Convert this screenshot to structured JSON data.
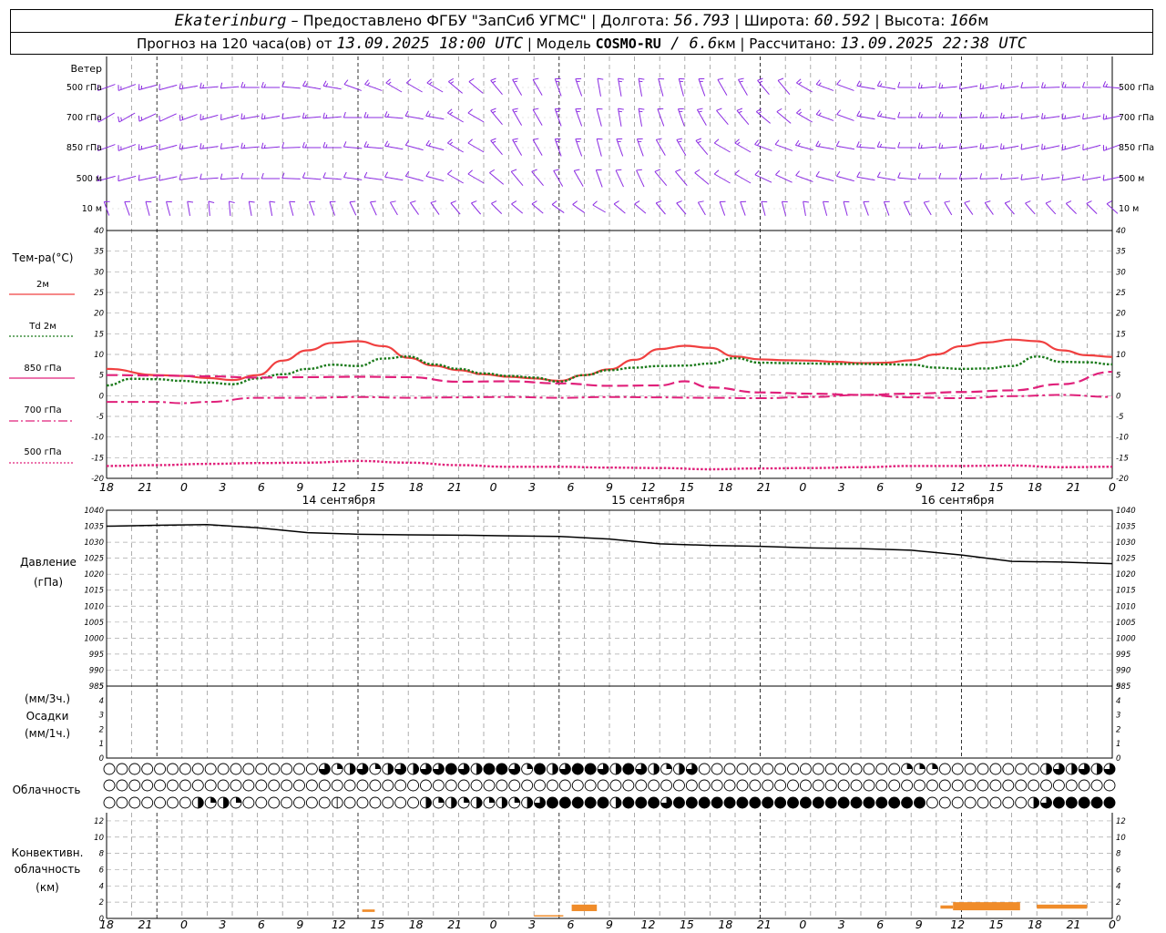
{
  "header": {
    "station": "Ekaterinburg",
    "dash": " – ",
    "provider": "Предоставлено ФГБУ \"ЗапСиб УГМС\"",
    "sep": " | ",
    "lon_label": "Долгота: ",
    "lon_value": "56.793",
    "lat_label": "Широта: ",
    "lat_value": "60.592",
    "alt_label": "Высота: ",
    "alt_value": "166",
    "alt_unit": "м",
    "forecast_prefix": "Прогноз на 120 часа(ов) от ",
    "forecast_time": "13.09.2025 18:00 UTC",
    "model_label": "Модель ",
    "model_name": "COSMO-RU",
    "model_res": " / 6.6",
    "model_unit": "км",
    "calc_label": "Рассчитано: ",
    "calc_time": "13.09.2025 22:38 UTC"
  },
  "wind_panel": {
    "title": "Ветер",
    "levels": [
      "500 гПа",
      "700 гПа",
      "850 гПа",
      "500 м",
      "10 м"
    ],
    "color": "#8b2be2"
  },
  "temp_panel": {
    "title": "Тем-ра(°C)",
    "legend": [
      {
        "label": "2м",
        "color": "#f04040",
        "style": "solid"
      },
      {
        "label": "Td  2м",
        "color": "#1a7a1a",
        "style": "dotted"
      },
      {
        "label": "850 гПа",
        "color": "#e0207a",
        "style": "dashed"
      },
      {
        "label": "700 гПа",
        "color": "#e0207a",
        "style": "dashdot"
      },
      {
        "label": "500 гПа",
        "color": "#e0207a",
        "style": "dotted"
      }
    ],
    "yticks": [
      "40",
      "35",
      "30",
      "25",
      "20",
      "15",
      "10",
      "5",
      "0",
      "-5",
      "-10",
      "-15",
      "-20"
    ]
  },
  "pressure_panel": {
    "title": "Давление",
    "unit": "(гПа)",
    "yticks": [
      "1040",
      "1035",
      "1030",
      "1025",
      "1020",
      "1015",
      "1010",
      "1005",
      "1000",
      "995",
      "990",
      "985"
    ]
  },
  "precip_panel": {
    "unit_top": "(мм/3ч.)",
    "title": "Осадки",
    "unit_bottom": "(мм/1ч.)",
    "yticks": [
      "5",
      "4",
      "3",
      "2",
      "1",
      "0"
    ]
  },
  "cloud_panel": {
    "title": "Облачность"
  },
  "conv_panel": {
    "title_line1": "Конвективн.",
    "title_line2": "облачность",
    "unit": "(км)",
    "yticks": [
      "12",
      "10",
      "8",
      "6",
      "4",
      "2",
      "0"
    ],
    "color": "#f08c2a"
  },
  "time_axis": {
    "labels": [
      "18",
      "21",
      "0",
      "3",
      "6",
      "9",
      "12",
      "15",
      "18",
      "21",
      "0",
      "3",
      "6",
      "9",
      "12",
      "15",
      "18",
      "21",
      "0",
      "3",
      "6",
      "9",
      "12",
      "15",
      "18",
      "21",
      "0"
    ],
    "dates": [
      {
        "label": "14 сентября",
        "hour_index": 6
      },
      {
        "label": "15 сентября",
        "hour_index": 14
      },
      {
        "label": "16 сентября",
        "hour_index": 22
      }
    ]
  },
  "chart_data": [
    {
      "type": "line",
      "title": "Тем-ра(°C)",
      "x_unit": "hours from 13.09.2025 18:00 UTC",
      "ylim": [
        -20,
        40
      ],
      "series": [
        {
          "name": "2м",
          "x": [
            0,
            6,
            9,
            12,
            15,
            18,
            21,
            24,
            27,
            30,
            33,
            36,
            39,
            42,
            45,
            48,
            51,
            54,
            57,
            60,
            63,
            66,
            69,
            72,
            75,
            78,
            81,
            84,
            87,
            90,
            93,
            96,
            99,
            102,
            105,
            108,
            111,
            114,
            117,
            120
          ],
          "values": [
            6.5,
            5,
            4.8,
            4.3,
            3.8,
            5,
            8.5,
            11,
            12.8,
            13.2,
            12,
            9.2,
            7.3,
            6.2,
            5.2,
            4.6,
            4.2,
            3.6,
            5,
            6.4,
            8.7,
            11.3,
            12.1,
            11.6,
            9.5,
            8.8,
            8.6,
            8.5,
            8.2,
            7.9,
            8,
            8.6,
            10,
            12,
            12.9,
            13.6,
            13.2,
            11,
            9.8,
            9.4
          ]
        },
        {
          "name": "Td  2м",
          "x": [
            0,
            3,
            6,
            9,
            12,
            15,
            18,
            21,
            24,
            27,
            30,
            33,
            36,
            39,
            42,
            45,
            48,
            51,
            54,
            57,
            60,
            63,
            66,
            69,
            72,
            75,
            78,
            81,
            84,
            87,
            90,
            93,
            96,
            99,
            102,
            105,
            108,
            111,
            114,
            117,
            120
          ],
          "values": [
            2.5,
            4.1,
            4,
            3.6,
            3.2,
            2.8,
            4.2,
            5.2,
            6.5,
            7.5,
            7.2,
            9,
            9.5,
            7.6,
            6.5,
            5.4,
            4.8,
            4.4,
            3.4,
            5,
            6.2,
            6.8,
            7.2,
            7.3,
            7.8,
            9.1,
            8,
            7.9,
            7.8,
            7.7,
            7.7,
            7.6,
            7.5,
            6.8,
            6.5,
            6.6,
            7.2,
            9.5,
            8.2,
            8.1,
            7.6
          ]
        },
        {
          "name": "850 гПа",
          "x": [
            0,
            6,
            12,
            18,
            24,
            30,
            36,
            42,
            48,
            54,
            60,
            66,
            69,
            72,
            78,
            84,
            90,
            96,
            102,
            108,
            114,
            120
          ],
          "values": [
            5,
            4.9,
            4.7,
            4.4,
            4.5,
            4.6,
            4.5,
            3.4,
            3.5,
            3,
            2.4,
            2.5,
            3.5,
            2,
            0.8,
            0.5,
            0.2,
            0.5,
            0.9,
            1.3,
            2.8,
            5.8
          ]
        },
        {
          "name": "700 гПа",
          "x": [
            0,
            6,
            9,
            12,
            18,
            24,
            30,
            36,
            42,
            48,
            54,
            60,
            66,
            72,
            78,
            84,
            90,
            96,
            102,
            108,
            114,
            120
          ],
          "values": [
            -1.5,
            -1.5,
            -1.8,
            -1.5,
            -0.5,
            -0.5,
            -0.3,
            -0.5,
            -0.4,
            -0.3,
            -0.5,
            -0.3,
            -0.4,
            -0.5,
            -0.6,
            -0.3,
            0.2,
            -0.4,
            -0.6,
            -0.1,
            0.2,
            -0.3
          ]
        },
        {
          "name": "500 гПа",
          "x": [
            0,
            6,
            12,
            18,
            24,
            30,
            36,
            42,
            48,
            54,
            60,
            66,
            72,
            78,
            84,
            90,
            96,
            102,
            108,
            114,
            120
          ],
          "values": [
            -17,
            -16.8,
            -16.5,
            -16.3,
            -16.2,
            -15.8,
            -16.2,
            -16.8,
            -17.2,
            -17.2,
            -17.4,
            -17.5,
            -17.8,
            -17.6,
            -17.5,
            -17.3,
            -17,
            -17,
            -16.9,
            -17.3,
            -17.2
          ]
        }
      ]
    },
    {
      "type": "line",
      "title": "Давление",
      "x_unit": "hours from 13.09.2025 18:00 UTC",
      "ylim": [
        985,
        1040
      ],
      "series": [
        {
          "name": "",
          "x": [
            0,
            6,
            12,
            18,
            24,
            30,
            36,
            42,
            48,
            54,
            60,
            66,
            72,
            78,
            84,
            90,
            96,
            102,
            108,
            114,
            120
          ],
          "values": [
            1035,
            1035.3,
            1035.5,
            1034.5,
            1033,
            1032.5,
            1032.3,
            1032.2,
            1032,
            1031.8,
            1031,
            1029.5,
            1029,
            1028.7,
            1028.2,
            1028,
            1027.5,
            1026,
            1024,
            1023.8,
            1023.3
          ]
        }
      ]
    },
    {
      "type": "bar",
      "title": "Конвективн. облачность",
      "x_unit": "hours from 13.09.2025 18:00 UTC",
      "ylim": [
        0,
        13
      ],
      "segments": [
        {
          "x_start": 30.5,
          "x_end": 32,
          "bottom": 0.8,
          "top": 1.1
        },
        {
          "x_start": 51,
          "x_end": 54.5,
          "bottom": 0.3,
          "top": 0.4
        },
        {
          "x_start": 55.5,
          "x_end": 58.5,
          "bottom": 0.9,
          "top": 1.7
        },
        {
          "x_start": 99.5,
          "x_end": 101,
          "bottom": 1.2,
          "top": 1.6
        },
        {
          "x_start": 101,
          "x_end": 109,
          "bottom": 1.0,
          "top": 2.0
        },
        {
          "x_start": 111,
          "x_end": 117,
          "bottom": 1.2,
          "top": 1.7
        }
      ]
    }
  ]
}
